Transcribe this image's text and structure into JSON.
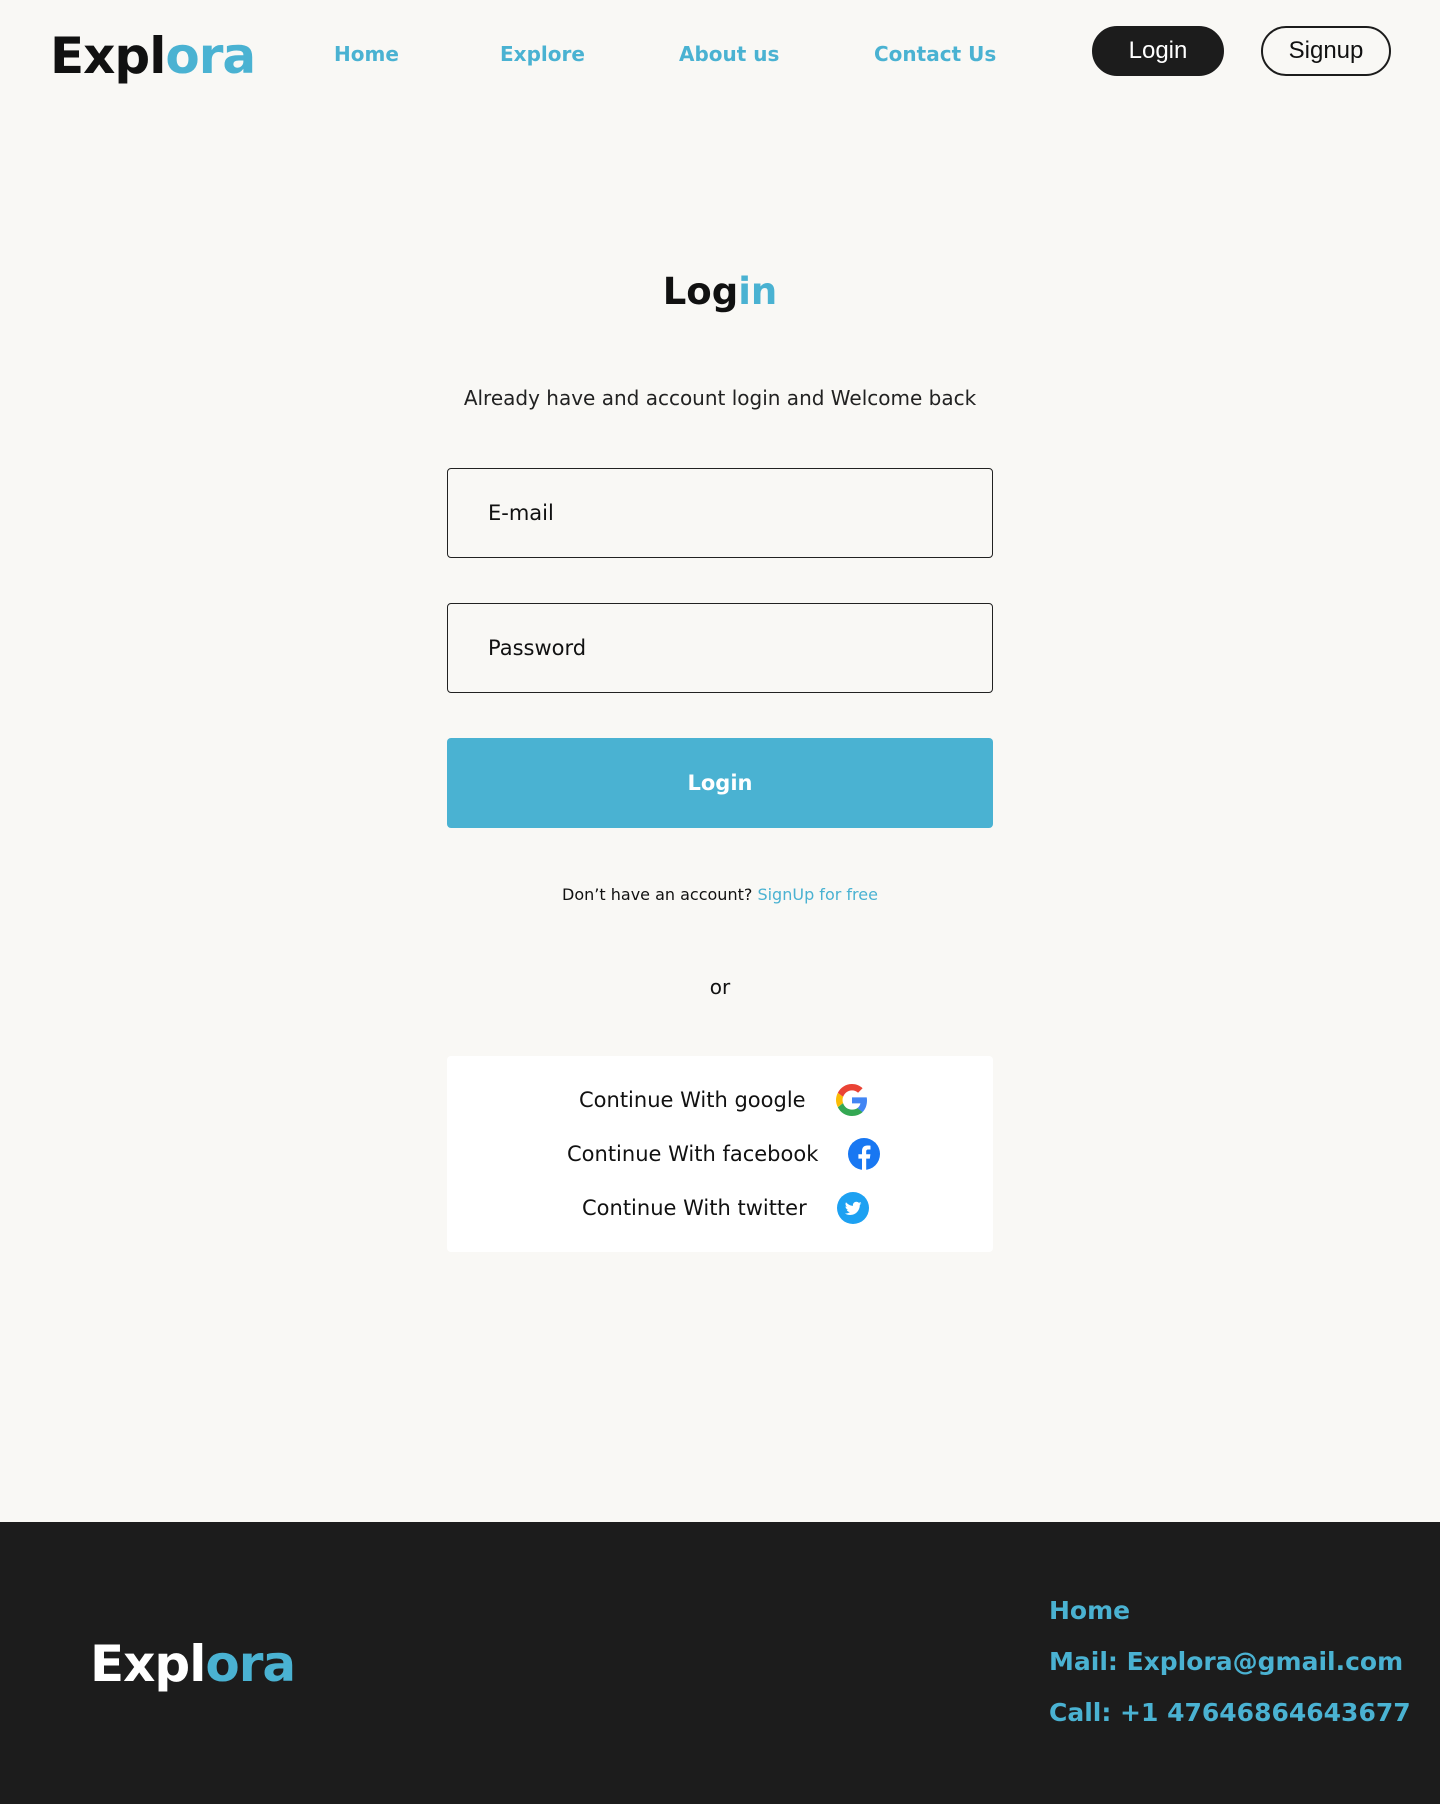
{
  "header": {
    "logo_part1": "Expl",
    "logo_part2": "ora",
    "nav": [
      "Home",
      "Explore",
      "About us",
      "Contact Us"
    ],
    "login_label": "Login",
    "signup_label": "Signup"
  },
  "main": {
    "title_part1": "Log",
    "title_part2": "in",
    "subtitle": "Already have and account login and Welcome back",
    "email_placeholder": "E-mail",
    "password_placeholder": "Password",
    "submit_label": "Login",
    "no_account_text": "Don’t have an account?",
    "signup_link": "SignUp for free",
    "or_text": "or",
    "social": [
      {
        "label": "Continue With google",
        "icon": "google-icon"
      },
      {
        "label": "Continue With facebook",
        "icon": "facebook-icon"
      },
      {
        "label": "Continue With twitter",
        "icon": "twitter-icon"
      }
    ]
  },
  "footer": {
    "logo_part1": "Expl",
    "logo_part2": "ora",
    "home": "Home",
    "mail": "Mail: Explora@gmail.com",
    "call": "Call: +1 47646864643677"
  },
  "colors": {
    "accent": "#4ab2d2",
    "dark": "#1c1c1c",
    "background": "#f9f8f5"
  }
}
